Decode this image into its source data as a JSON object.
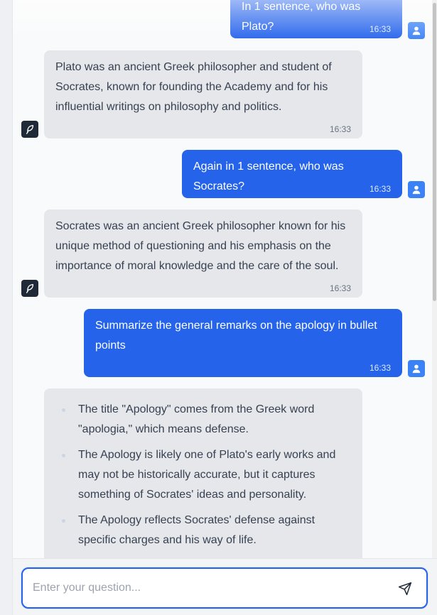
{
  "messages": [
    {
      "role": "user",
      "text": "In 1 sentence, who was Plato?",
      "time": "16:33"
    },
    {
      "role": "assistant",
      "text": "Plato was an ancient Greek philosopher and student of Socrates, known for founding the Academy and for his influential writings on philosophy and politics.",
      "time": "16:33"
    },
    {
      "role": "user",
      "text": "Again in 1 sentence, who was Socrates?",
      "time": "16:33"
    },
    {
      "role": "assistant",
      "text": "Socrates was an ancient Greek philosopher known for his unique method of questioning and his emphasis on the importance of moral knowledge and the care of the soul.",
      "time": "16:33"
    },
    {
      "role": "user",
      "text": "Summarize the general remarks on the apology in bullet points",
      "time": "16:33"
    },
    {
      "role": "assistant",
      "bullets": [
        "The title \"Apology\" comes from the Greek word \"apologia,\" which means defense.",
        "The Apology is likely one of Plato's early works and may not be historically accurate, but it captures something of Socrates' ideas and personality.",
        "The Apology reflects Socrates' defense against specific charges and his way of life."
      ]
    }
  ],
  "input": {
    "placeholder": "Enter your question..."
  },
  "icons": {
    "user": "user-icon",
    "assistant": "feather-icon",
    "send": "send-icon"
  },
  "colors": {
    "accent": "#2563eb",
    "user_avatar": "#3b82f6",
    "bot_avatar": "#1f2937",
    "bot_bubble": "#e5e7eb"
  }
}
